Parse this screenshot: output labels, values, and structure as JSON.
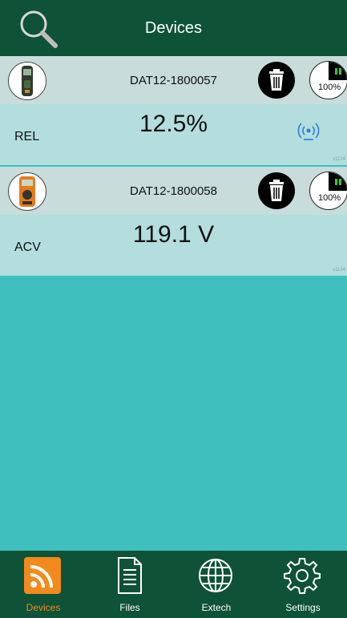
{
  "header": {
    "title": "Devices",
    "search_icon": "search-icon"
  },
  "devices": [
    {
      "id": "DAT12-1800057",
      "mode": "REL",
      "reading": "12.5%",
      "battery": "100%",
      "connection_icon": "wireless-signal-icon",
      "version": "v1124"
    },
    {
      "id": "DAT12-1800058",
      "mode": "ACV",
      "reading": "119.1 V",
      "battery": "100%",
      "version": "v1124"
    }
  ],
  "nav": [
    {
      "label": "Devices",
      "icon": "rss-icon",
      "active": true
    },
    {
      "label": "Files",
      "icon": "file-icon",
      "active": false
    },
    {
      "label": "Extech",
      "icon": "globe-icon",
      "active": false
    },
    {
      "label": "Settings",
      "icon": "gear-icon",
      "active": false
    }
  ],
  "colors": {
    "header": "#0e5237",
    "background": "#3fbfbd",
    "row_top": "#c7dcdb",
    "row_bottom": "#b3dedd",
    "accent": "#f28a1c",
    "signal": "#2b7de0"
  }
}
